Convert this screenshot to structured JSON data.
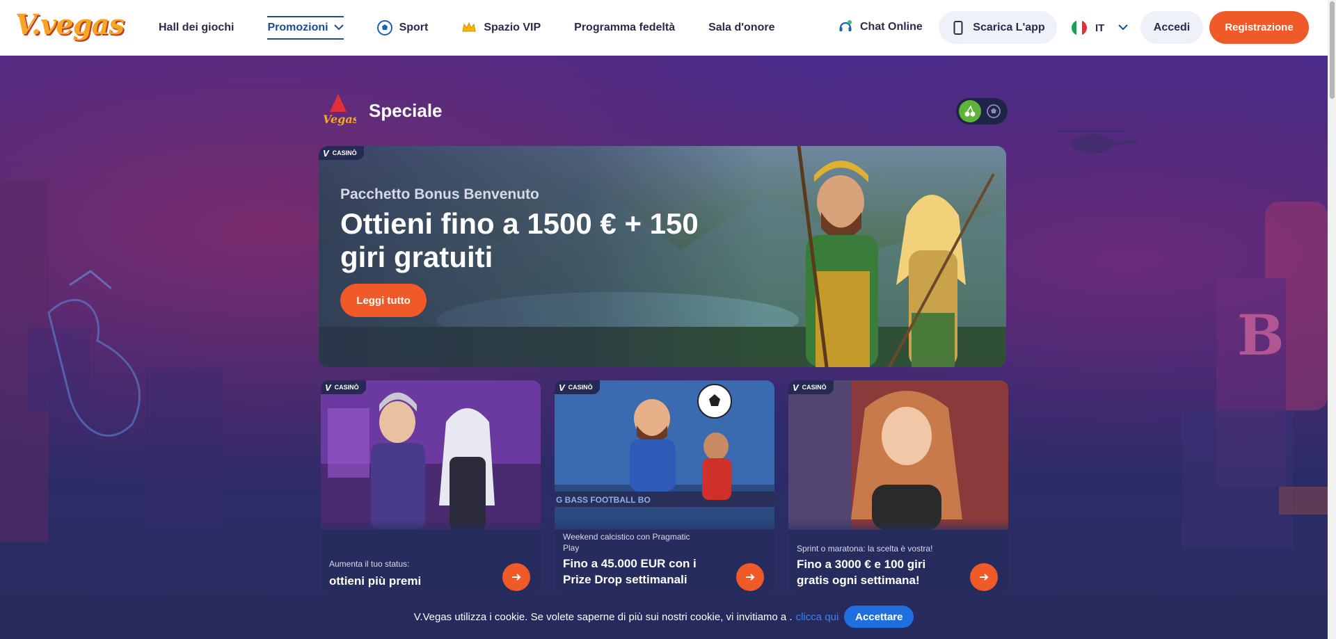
{
  "brand": {
    "logo_text": "V.vegas",
    "accent": "#f05a28",
    "nav_active": "#1a4d8f"
  },
  "nav": {
    "items": [
      {
        "label": "Hall dei giochi",
        "icon": null
      },
      {
        "label": "Promozioni",
        "icon": "chevron-down-icon",
        "active": true
      },
      {
        "label": "Sport",
        "icon": "soccer-ball-icon"
      },
      {
        "label": "Spazio VIP",
        "icon": "crown-icon"
      },
      {
        "label": "Programma fedeltà",
        "icon": null
      },
      {
        "label": "Sala d'onore",
        "icon": null
      }
    ]
  },
  "header": {
    "chat_label": "Chat Online",
    "app_label": "Scarica L'app",
    "lang_code": "IT",
    "login_label": "Accedi",
    "register_label": "Registrazione"
  },
  "section": {
    "title": "Speciale",
    "logo_text": "Vegas",
    "toggle": [
      {
        "icon": "cherry-icon",
        "active": true
      },
      {
        "icon": "soccer-ball-icon",
        "active": false
      }
    ]
  },
  "hero": {
    "badge": "CASINÒ",
    "subtitle": "Pacchetto Bonus Benvenuto",
    "title": "Ottieni fino a 1500 € + 150 giri gratuiti",
    "button": "Leggi tutto"
  },
  "cards": [
    {
      "badge": "CASINÒ",
      "subtitle": "Aumenta il tuo status:",
      "title": "ottieni più premi"
    },
    {
      "badge": "CASINÒ",
      "subtitle": "Weekend calcistico con Pragmatic Play",
      "title": "Fino a 45.000 EUR con i Prize Drop settimanali",
      "art_text": "G BASS FOOTBALL BO"
    },
    {
      "badge": "CASINÒ",
      "subtitle": "Sprint o maratona: la scelta è vostra!",
      "title": "Fino a 3000 € e 100 giri gratis ogni settimana!"
    }
  ],
  "cookie": {
    "text": "V.Vegas utilizza i cookie. Se volete saperne di più sui nostri cookie, vi invitiamo a .",
    "link": "clicca qui",
    "button": "Accettare"
  }
}
